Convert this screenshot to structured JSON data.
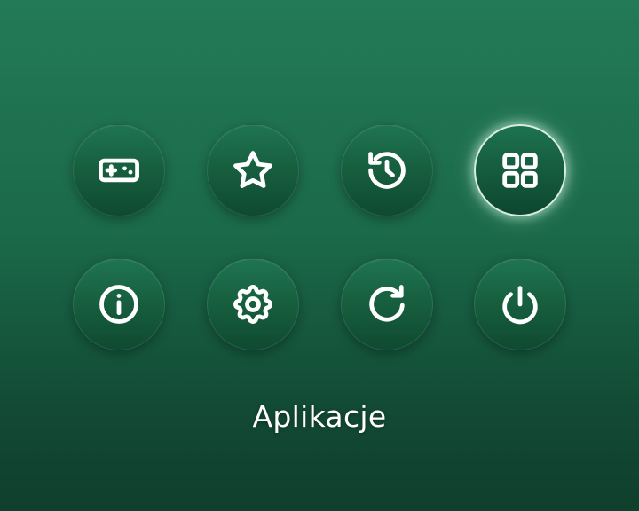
{
  "menu": {
    "selected_label": "Aplikacje",
    "items": [
      {
        "icon": "gamepad-icon"
      },
      {
        "icon": "star-icon"
      },
      {
        "icon": "history-icon"
      },
      {
        "icon": "grid-apps-icon",
        "selected": true
      },
      {
        "icon": "info-icon"
      },
      {
        "icon": "gear-icon"
      },
      {
        "icon": "refresh-icon"
      },
      {
        "icon": "power-icon"
      }
    ]
  },
  "colors": {
    "background_top": "#237a57",
    "background_bottom": "#0f3f2d",
    "icon": "#ffffff",
    "selected_ring": "#d8eee3"
  }
}
